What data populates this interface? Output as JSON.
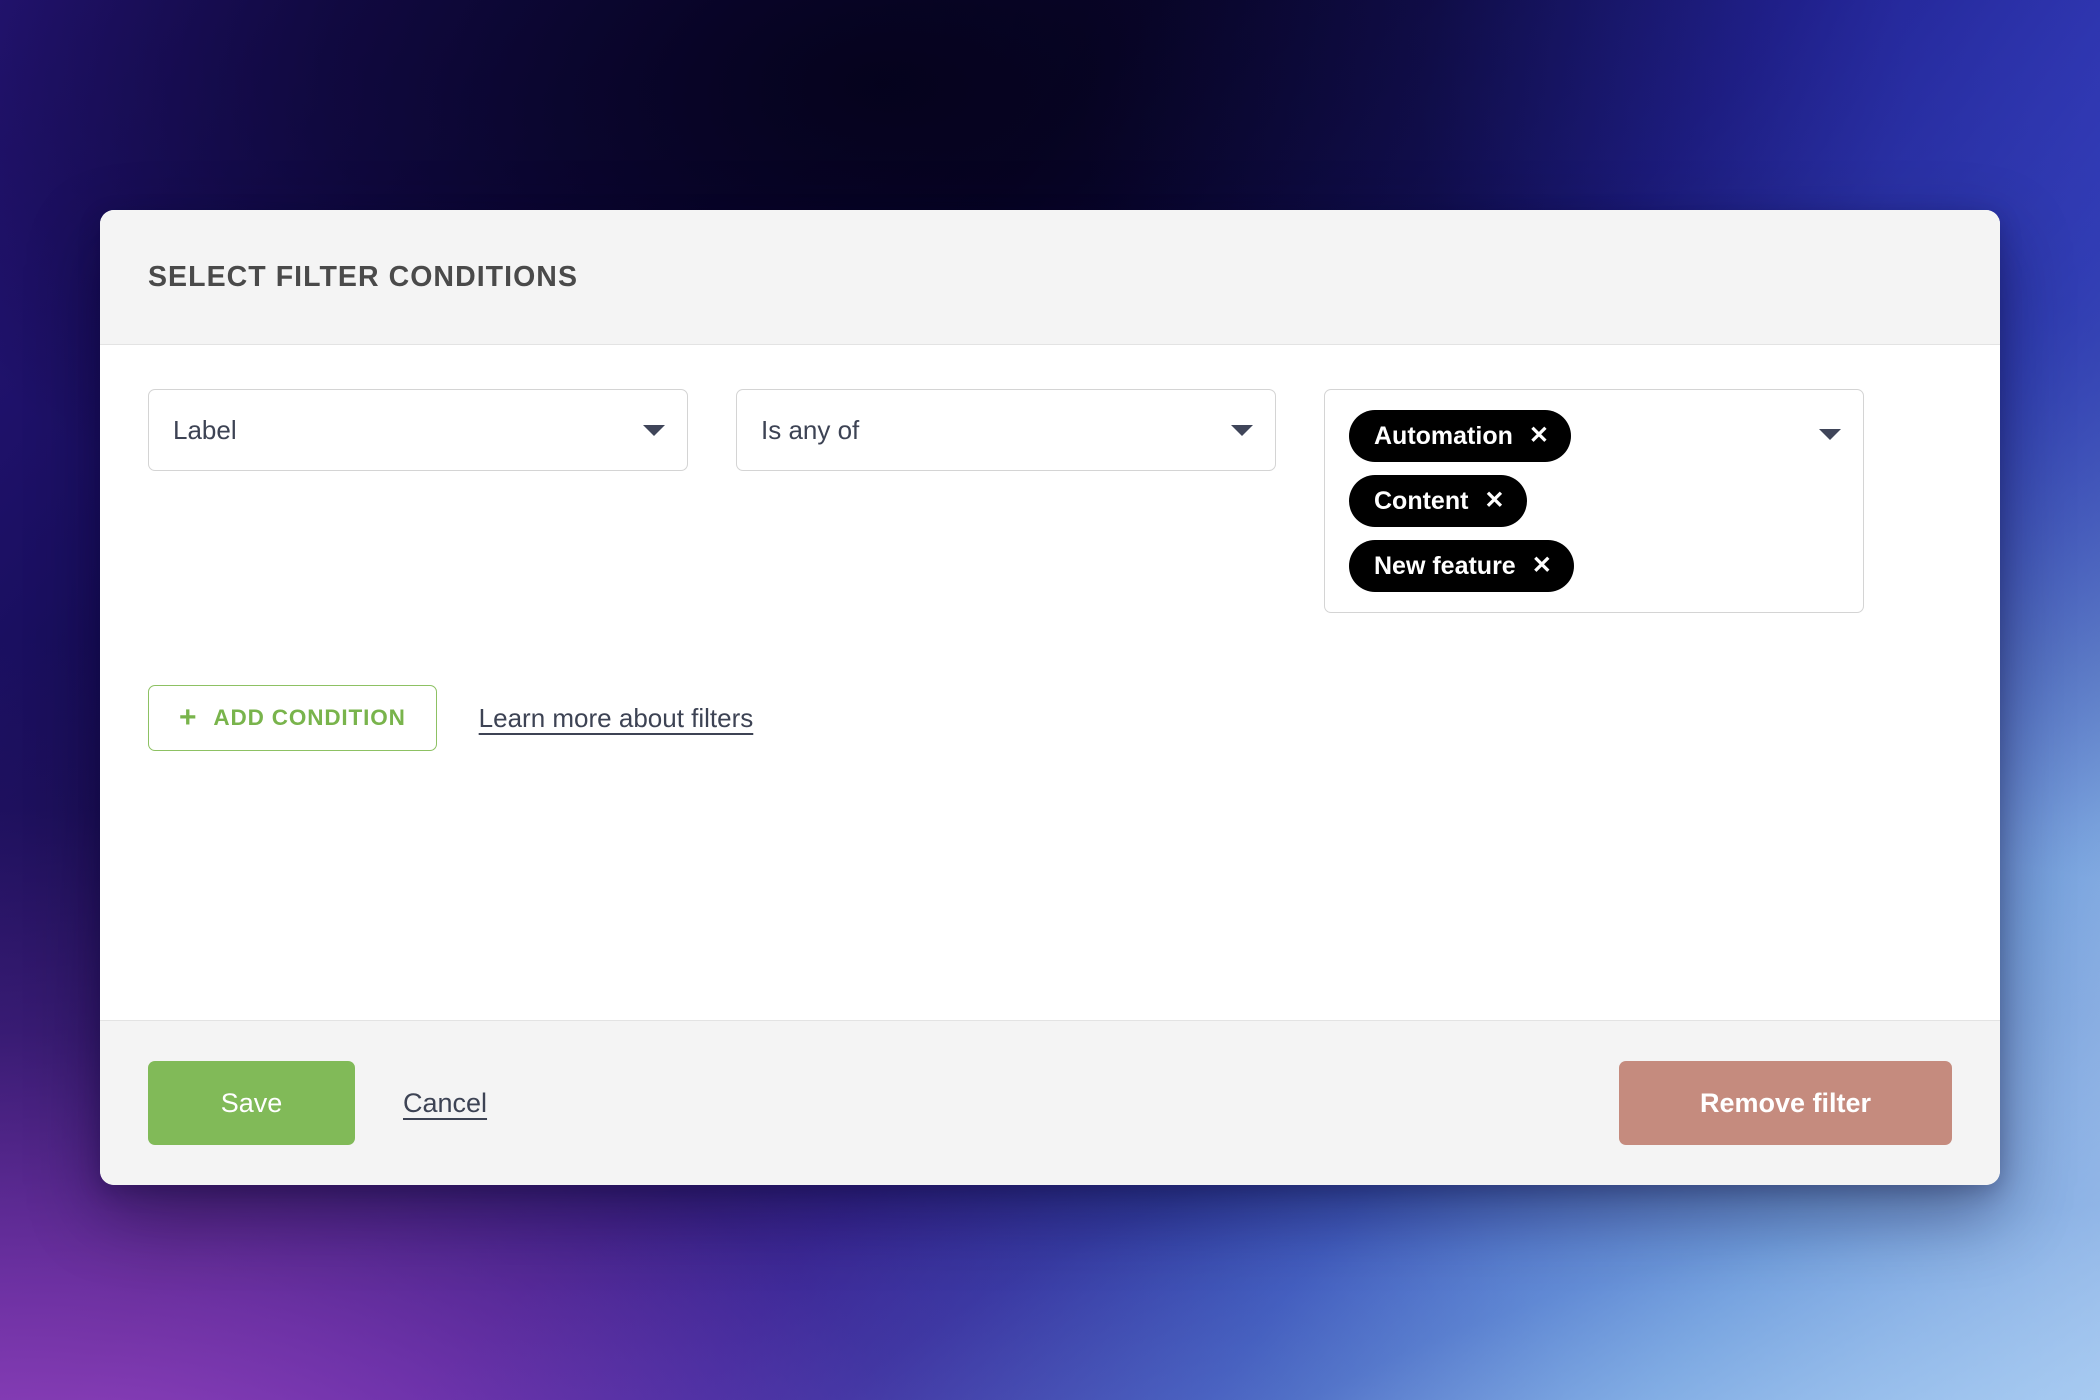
{
  "theme": {
    "accent_green": "#81ba58",
    "accent_green_outline": "#8dc163",
    "danger_rose": "#c58b7e",
    "chip_bg": "#000000",
    "text_dark": "#3d4354",
    "header_bg": "#f4f4f4"
  },
  "dialog": {
    "title": "SELECT FILTER CONDITIONS"
  },
  "condition": {
    "attribute": {
      "value": "Label",
      "caret_icon": "chevron-down-icon"
    },
    "operator": {
      "value": "Is any of",
      "caret_icon": "chevron-down-icon"
    },
    "values": {
      "caret_icon": "chevron-down-icon",
      "remove_icon": "close-icon",
      "tags": [
        {
          "label": "Automation",
          "remove": "✕"
        },
        {
          "label": "Content",
          "remove": "✕"
        },
        {
          "label": "New feature",
          "remove": "✕"
        }
      ]
    }
  },
  "actions": {
    "add_condition_label": "ADD CONDITION",
    "add_condition_icon": "plus-icon",
    "add_condition_plus": "+",
    "learn_more_label": "Learn more about filters"
  },
  "footer": {
    "save_label": "Save",
    "cancel_label": "Cancel",
    "remove_filter_label": "Remove filter"
  }
}
